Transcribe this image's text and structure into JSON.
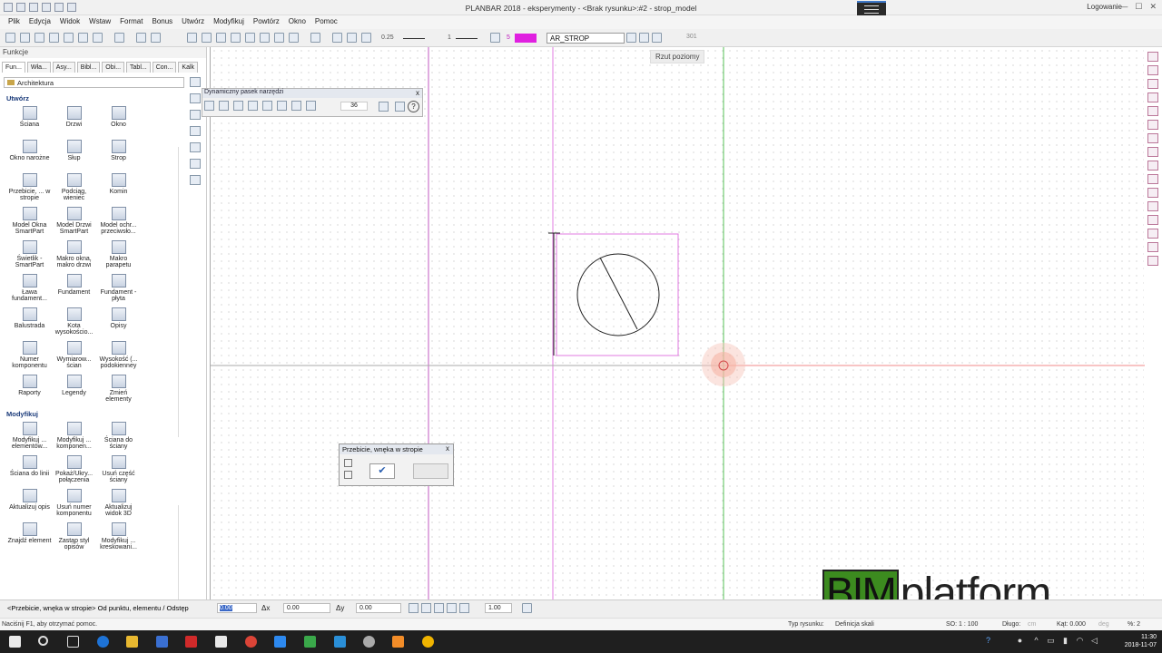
{
  "window": {
    "title": "PLANBAR 2018 - eksperymenty - <Brak rysunku>:#2 - strop_model",
    "login": "Logowanie",
    "controls": {
      "minimize": "—",
      "maximize": "☐",
      "close": "✕"
    }
  },
  "menu": [
    "Plik",
    "Edycja",
    "Widok",
    "Wstaw",
    "Format",
    "Bonus",
    "Utwórz",
    "Modyfikuj",
    "Powtórz",
    "Okno",
    "Pomoc"
  ],
  "toolbar": {
    "pen_width": "0.25",
    "line_type": "1",
    "layer": "AR_STROP",
    "color_number": "5",
    "accent": "#e020e0",
    "extra": "301"
  },
  "view_tab": "Rzut poziomy",
  "sidebar": {
    "header": "Funkcje",
    "tabs": [
      "Fun...",
      "Wła...",
      "Asy...",
      "Bibl...",
      "Obi...",
      "Tabl...",
      "Con...",
      "Kalk"
    ],
    "category": "Architektura",
    "section_create": "Utwórz",
    "create_tools": [
      "Ściana",
      "Drzwi",
      "Okno",
      "Okno narożne",
      "Słup",
      "Strop",
      "Przebicie, ... w stropie",
      "Podciąg, wieniec",
      "Komin",
      "Model Okna SmartPart",
      "Model Drzwi SmartPart",
      "Model ochr... przeciwsło...",
      "Świetlik - SmartPart",
      "Makro okna, makro drzwi",
      "Makro parapetu",
      "Ława fundament...",
      "Fundament",
      "Fundament - płyta",
      "Balustrada",
      "Kota wysokościo...",
      "Opisy",
      "Numer komponentu",
      "Wymiarow... ścian",
      "Wysokość (... podokienney",
      "Raporty",
      "Legendy",
      "Zmień elementy"
    ],
    "section_modify": "Modyfikuj",
    "modify_tools": [
      "Modyfikuj ... elementów...",
      "Modyfikuj ... komponen...",
      "Ściana do ściany",
      "Ściana do linii",
      "Pokaż/Ukry... połączenia",
      "Usuń część ściany",
      "Aktualizuj opis",
      "Usuń numer komponentu",
      "Aktualizuj widok 3D",
      "Znajdź element",
      "Zastąp styl opisów",
      "Modyfikuj ... kreskowani..."
    ]
  },
  "dynamic_toolbar": {
    "title": "Dynamiczny pasek narzędzi",
    "value": "36",
    "close": "x"
  },
  "dialog": {
    "title": "Przebicie, wnęka w stropie",
    "ok": "✔",
    "close": "x"
  },
  "statusbar": {
    "prompt": "<Przebicie, wnęka w stropie> Od punktu, elementu / Odstęp",
    "prompt_value": "0.00",
    "dx_label": "Δx",
    "dx_value": "0.00",
    "dy_label": "Δy",
    "dy_value": "0.00",
    "scale_value": "1.00"
  },
  "hint": {
    "help": "Naciśnij F1, aby otrzymać pomoc.",
    "typ": "Typ rysunku:",
    "definicja": "Definicja skali",
    "so": "SO: 1 : 100",
    "dlug": "Długo:",
    "cm": "cm",
    "kat": "Kąt: 0.000",
    "deg": "deg",
    "pct": "%: 2"
  },
  "taskbar": {
    "time": "11:30",
    "date": "2018-11-07"
  },
  "logo": {
    "bim": "BIM",
    "platform": "platform"
  }
}
